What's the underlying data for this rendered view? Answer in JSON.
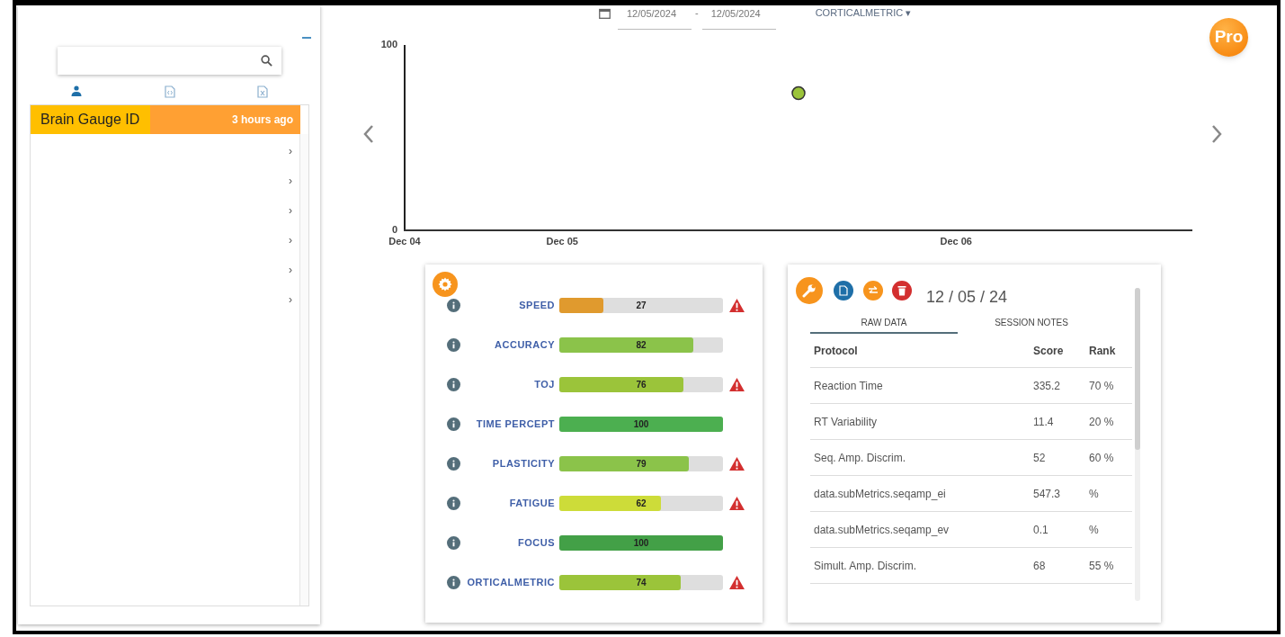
{
  "sidebar": {
    "tabs": [
      {
        "kind": "person",
        "selected": true
      },
      {
        "kind": "code-file",
        "selected": false
      },
      {
        "kind": "excel-file",
        "selected": false
      }
    ],
    "header": {
      "title": "Brain Gauge ID",
      "time": "3 hours ago"
    },
    "rows": [
      {
        "chevron": "›"
      },
      {
        "chevron": "›"
      },
      {
        "chevron": "›"
      },
      {
        "chevron": "›"
      },
      {
        "chevron": "›"
      },
      {
        "chevron": "›"
      }
    ]
  },
  "filter": {
    "start_date": "12/05/2024",
    "separator": "-",
    "end_date": "12/05/2024",
    "metric": "CORTICALMETRIC ▾"
  },
  "badge": "Pro",
  "chart_data": {
    "type": "scatter",
    "ylim": [
      0,
      100
    ],
    "yticks": [
      {
        "value": 0,
        "label": "0"
      },
      {
        "value": 100,
        "label": "100"
      }
    ],
    "categories": [
      "Dec 04",
      null,
      null,
      null,
      "Dec 05",
      null,
      null,
      null,
      null,
      null,
      null,
      null,
      null,
      null,
      "Dec 06",
      null,
      null,
      null,
      null,
      null,
      null
    ],
    "series": [
      {
        "color": "#9bc43a",
        "values": [
          null,
          null,
          null,
          null,
          null,
          null,
          null,
          null,
          null,
          null,
          74,
          null,
          null,
          null,
          null,
          null,
          null,
          null,
          null,
          null,
          null
        ]
      }
    ]
  },
  "metrics": [
    {
      "name": "SPEED",
      "value": "27",
      "level": 0.27,
      "color": "#e09a2e",
      "warning": true
    },
    {
      "name": "ACCURACY",
      "value": "82",
      "level": 0.82,
      "color": "#8bc34a",
      "warning": false
    },
    {
      "name": "TOJ",
      "value": "76",
      "level": 0.76,
      "color": "#9bc43a",
      "warning": true
    },
    {
      "name": "TIME PERCEPT",
      "value": "100",
      "level": 1,
      "color": "#4caf50",
      "warning": false
    },
    {
      "name": "PLASTICITY",
      "value": "79",
      "level": 0.79,
      "color": "#8bc34a",
      "warning": true
    },
    {
      "name": "FATIGUE",
      "value": "62",
      "level": 0.62,
      "color": "#cddc39",
      "warning": true
    },
    {
      "name": "FOCUS",
      "value": "100",
      "level": 1,
      "color": "#43a047",
      "warning": false
    },
    {
      "name": "ORTICALMETRIC",
      "value": "74",
      "level": 0.74,
      "color": "#9bc43a",
      "warning": true
    }
  ],
  "session": {
    "date": "12 / 05 / 24",
    "tabs": [
      {
        "label": "RAW DATA",
        "selected": true
      },
      {
        "label": "SESSION NOTES",
        "selected": false
      }
    ],
    "columns": [
      "Protocol",
      "Score",
      "Rank"
    ],
    "rows": [
      [
        "Reaction Time",
        "335.2",
        "70 %"
      ],
      [
        "RT Variability",
        "11.4",
        "20 %"
      ],
      [
        "Seq. Amp. Discrim.",
        "52",
        "60 %"
      ],
      [
        "data.subMetrics.seqamp_ei",
        "547.3",
        "%"
      ],
      [
        "data.subMetrics.seqamp_ev",
        "0.1",
        "%"
      ],
      [
        "Simult. Amp. Discrim.",
        "68",
        "55 %"
      ]
    ]
  }
}
